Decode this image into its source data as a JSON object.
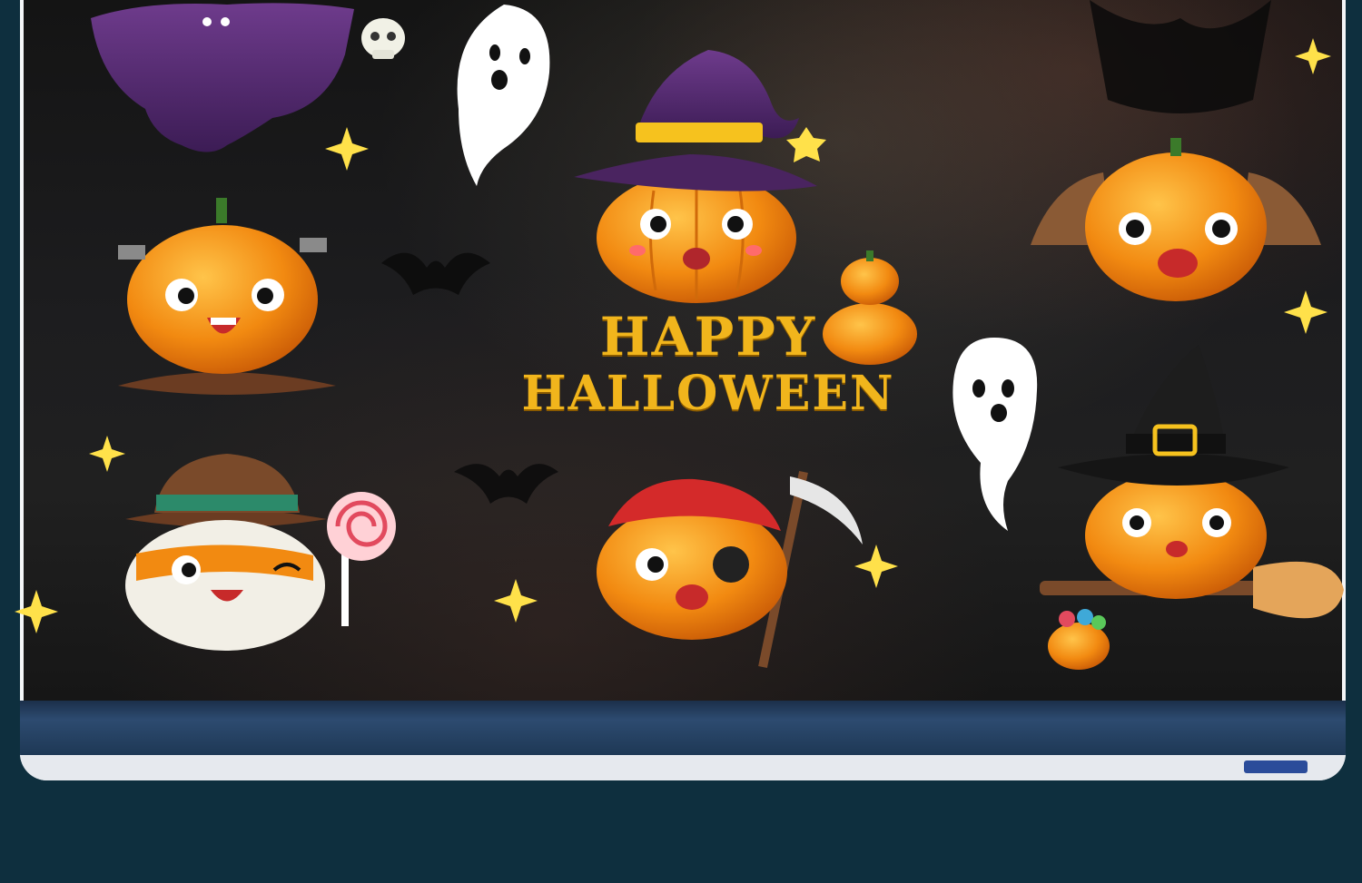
{
  "poster": {
    "title_line1": "HAPPY",
    "title_line2": "HALLOWEEN"
  },
  "colors": {
    "page_bg": "#0e2f3e",
    "pumpkin": "#f28a11",
    "title_gold": "#f1b51c",
    "ghost": "#ffffff",
    "witch_hat_purple": "#5b2c6f"
  },
  "decorations": [
    "purple-ghost",
    "skull",
    "white-ghost",
    "witch-pumpkin",
    "frankenstein-pumpkin",
    "owl-pumpkin",
    "mummy-pumpkin",
    "pirate-pumpkin",
    "broom-witch-pumpkin",
    "stacked-pumpkins",
    "bats",
    "stars",
    "lollipop",
    "scythe",
    "candy-bucket"
  ]
}
